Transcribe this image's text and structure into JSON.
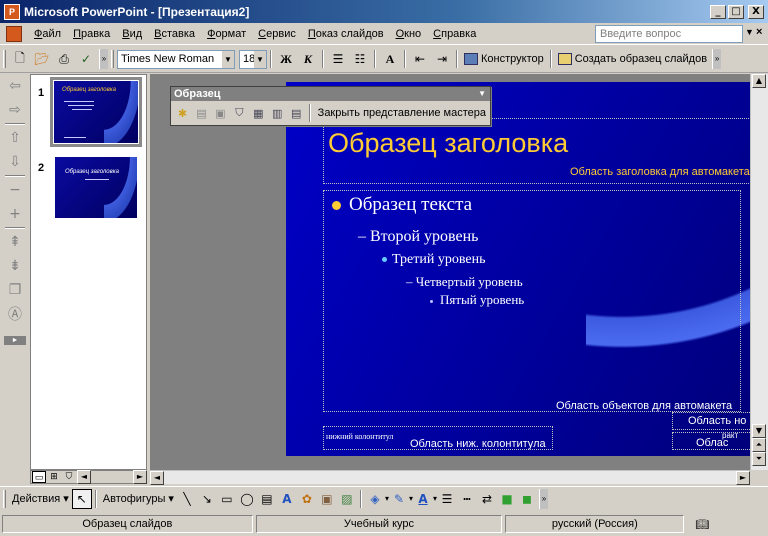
{
  "window": {
    "title": "Microsoft PowerPoint - [Презентация2]",
    "minimize": "_",
    "maximize": "□",
    "close": "X"
  },
  "menu": {
    "items": [
      "Файл",
      "Правка",
      "Вид",
      "Вставка",
      "Формат",
      "Сервис",
      "Показ слайдов",
      "Окно",
      "Справка"
    ],
    "ask_placeholder": "Введите вопрос",
    "close_glyph": "×"
  },
  "toolbar": {
    "font_name": "Times New Roman",
    "font_size": "18",
    "bold": "Ж",
    "italic": "К",
    "designer_label": "Конструктор",
    "create_master_label": "Создать образец слайдов"
  },
  "master_toolbar": {
    "title": "Образец",
    "close_master_label": "Закрыть представление мастера"
  },
  "slides": [
    {
      "number": "1",
      "thumb_title": "Образец заголовка"
    },
    {
      "number": "2",
      "thumb_title": "Образец заголовка"
    }
  ],
  "slide": {
    "title": "Образец заголовка",
    "title_area_label": "Область заголовка для автомакета",
    "levels": [
      "Образец текста",
      "– Второй уровень",
      "Третий уровень",
      "– Четвертый уровень",
      "Пятый уровень"
    ],
    "body_area_label": "Область объектов для автомакета",
    "footer_text": "нижний колонтитул",
    "footer_area_label": "Область ниж. колонтитула",
    "number_area_label": "Область но",
    "date_area_label": "Облас",
    "small_label": "ракт"
  },
  "drawbar": {
    "actions_label": "Действия",
    "autoshapes_label": "Автофигуры"
  },
  "status": {
    "view": "Образец слайдов",
    "design": "Учебный курс",
    "language": "русский (Россия)"
  },
  "colors": {
    "title_yellow": "#ffcc33",
    "slide_blue": "#0000c8",
    "swoosh_blue": "#3c5ae0"
  }
}
